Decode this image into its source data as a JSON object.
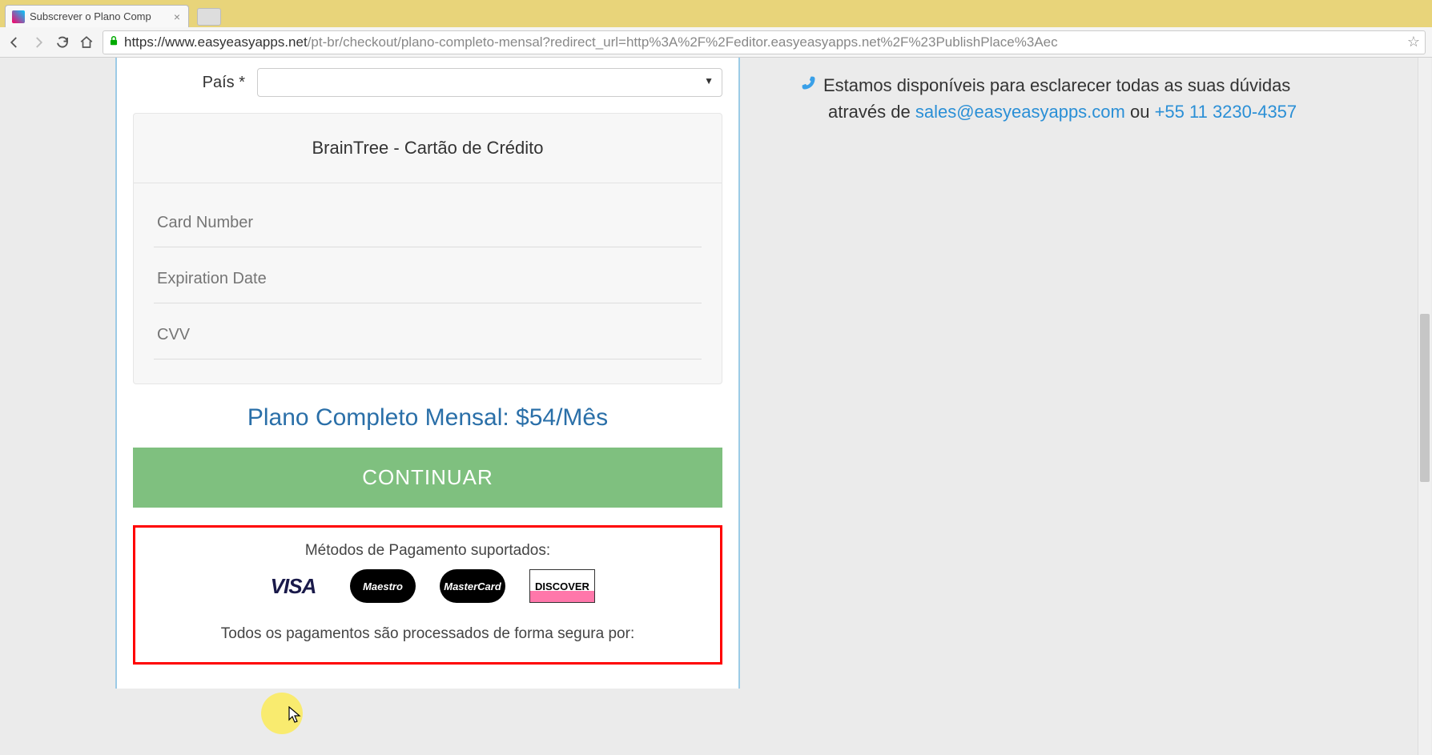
{
  "browser": {
    "tab_title": "Subscrever o Plano Comp",
    "url_host": "https://www.easyeasyapps.net",
    "url_path": "/pt-br/checkout/plano-completo-mensal?redirect_url=http%3A%2F%2Feditor.easyeasyapps.net%2F%23PublishPlace%3Aec"
  },
  "form": {
    "country_label": "País *",
    "payment_title": "BrainTree - Cartão de Crédito",
    "card_number_ph": "Card Number",
    "exp_ph": "Expiration Date",
    "cvv_ph": "CVV",
    "plan_line": "Plano Completo Mensal: $54/Mês",
    "continue_label": "CONTINUAR"
  },
  "methods": {
    "title": "Métodos de Pagamento suportados:",
    "visa": "VISA",
    "maestro": "Maestro",
    "mastercard": "MasterCard",
    "discover": "DISCOVER",
    "secure_line": "Todos os pagamentos são processados de forma segura por:"
  },
  "sidebar": {
    "text1": "Estamos disponíveis para esclarecer todas as suas dúvidas",
    "text2_prefix": "através de ",
    "email": "sales@easyeasyapps.com",
    "text2_mid": " ou ",
    "phone": "+55 11 3230-4357"
  }
}
